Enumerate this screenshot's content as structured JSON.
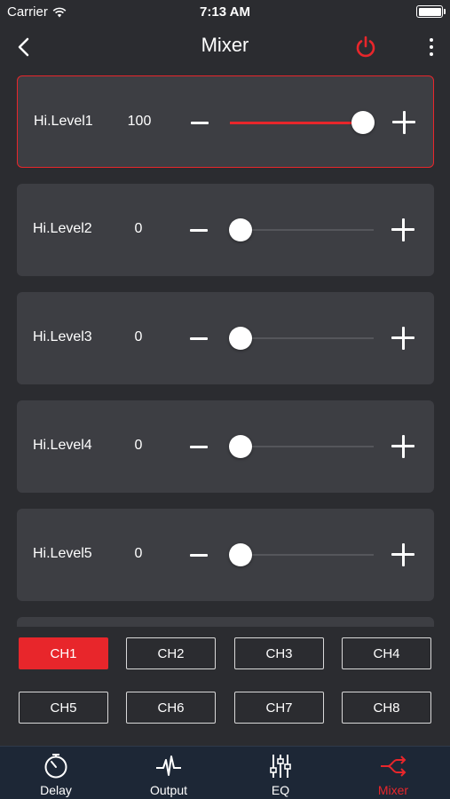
{
  "status_bar": {
    "carrier": "Carrier",
    "time": "7:13 AM"
  },
  "nav": {
    "title": "Mixer",
    "power_color": "#e8262b"
  },
  "slider_max": 100,
  "rows": [
    {
      "label": "Hi.Level1",
      "value": "100",
      "level": 100,
      "active": true
    },
    {
      "label": "Hi.Level2",
      "value": "0",
      "level": 0,
      "active": false
    },
    {
      "label": "Hi.Level3",
      "value": "0",
      "level": 0,
      "active": false
    },
    {
      "label": "Hi.Level4",
      "value": "0",
      "level": 0,
      "active": false
    },
    {
      "label": "Hi.Level5",
      "value": "0",
      "level": 0,
      "active": false
    }
  ],
  "channels": [
    {
      "label": "CH1",
      "selected": true
    },
    {
      "label": "CH2",
      "selected": false
    },
    {
      "label": "CH3",
      "selected": false
    },
    {
      "label": "CH4",
      "selected": false
    },
    {
      "label": "CH5",
      "selected": false
    },
    {
      "label": "CH6",
      "selected": false
    },
    {
      "label": "CH7",
      "selected": false
    },
    {
      "label": "CH8",
      "selected": false
    }
  ],
  "tabs": [
    {
      "label": "Delay",
      "icon": "stopwatch-icon",
      "active": false
    },
    {
      "label": "Output",
      "icon": "waveform-icon",
      "active": false
    },
    {
      "label": "EQ",
      "icon": "equalizer-sliders-icon",
      "active": false
    },
    {
      "label": "Mixer",
      "icon": "shuffle-icon",
      "active": true
    }
  ],
  "colors": {
    "accent": "#e8262b",
    "background": "#2b2c30",
    "row_background": "#3d3e43",
    "tab_bar_background": "#1d2736"
  }
}
